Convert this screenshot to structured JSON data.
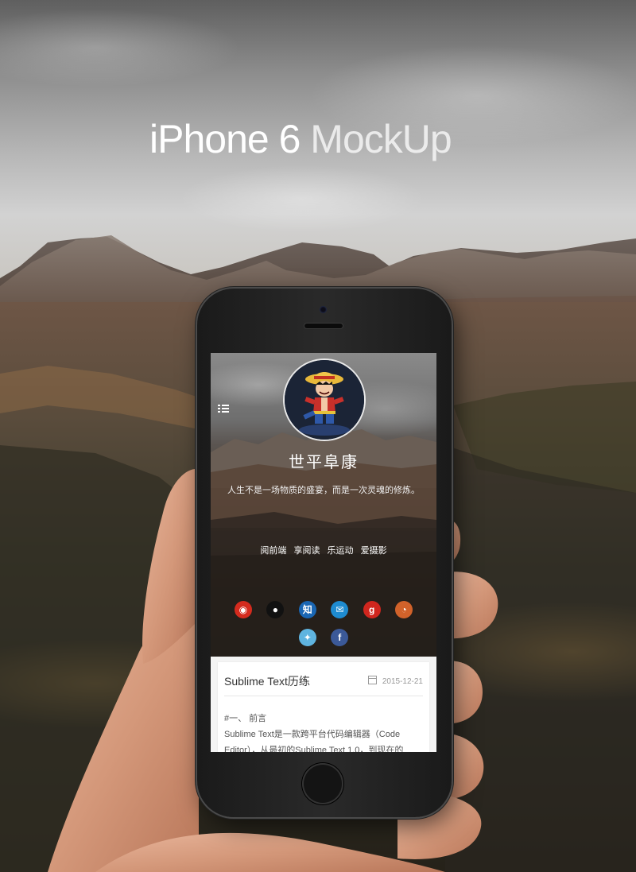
{
  "title": {
    "strong": "iPhone 6",
    "light": "MockUp"
  },
  "app": {
    "menu_icon": "list-icon",
    "avatar_icon": "cartoon-pirate-avatar",
    "site_name": "世平阜康",
    "motto": "人生不是一场物质的盛宴，而是一次灵魂的修炼。",
    "nav": [
      "阅前端",
      "享阅读",
      "乐运动",
      "爱摄影"
    ],
    "social": [
      {
        "name": "weibo-icon",
        "glyph": "◉",
        "color": "#d52b1e"
      },
      {
        "name": "github-icon",
        "glyph": "●",
        "color": "#111111"
      },
      {
        "name": "zhihu-icon",
        "glyph": "知",
        "color": "#1a66b3"
      },
      {
        "name": "mail-icon",
        "glyph": "✉",
        "color": "#1e8bd0"
      },
      {
        "name": "google-plus-icon",
        "glyph": "g",
        "color": "#d0261e"
      },
      {
        "name": "rss-icon",
        "glyph": "◔",
        "color": "#d1622a"
      },
      {
        "name": "twitter-icon",
        "glyph": "✦",
        "color": "#5fb4e0"
      },
      {
        "name": "facebook-icon",
        "glyph": "f",
        "color": "#3b5998"
      }
    ],
    "post": {
      "title": "Sublime Text历练",
      "date": "2015-12-21",
      "date_icon": "calendar-icon",
      "lines": [
        "#一、 前言",
        "Sublime Text是一款跨平台代码编辑器（Code",
        "Editor），从最初的Sublime Text 1.0，到现在的"
      ]
    }
  }
}
